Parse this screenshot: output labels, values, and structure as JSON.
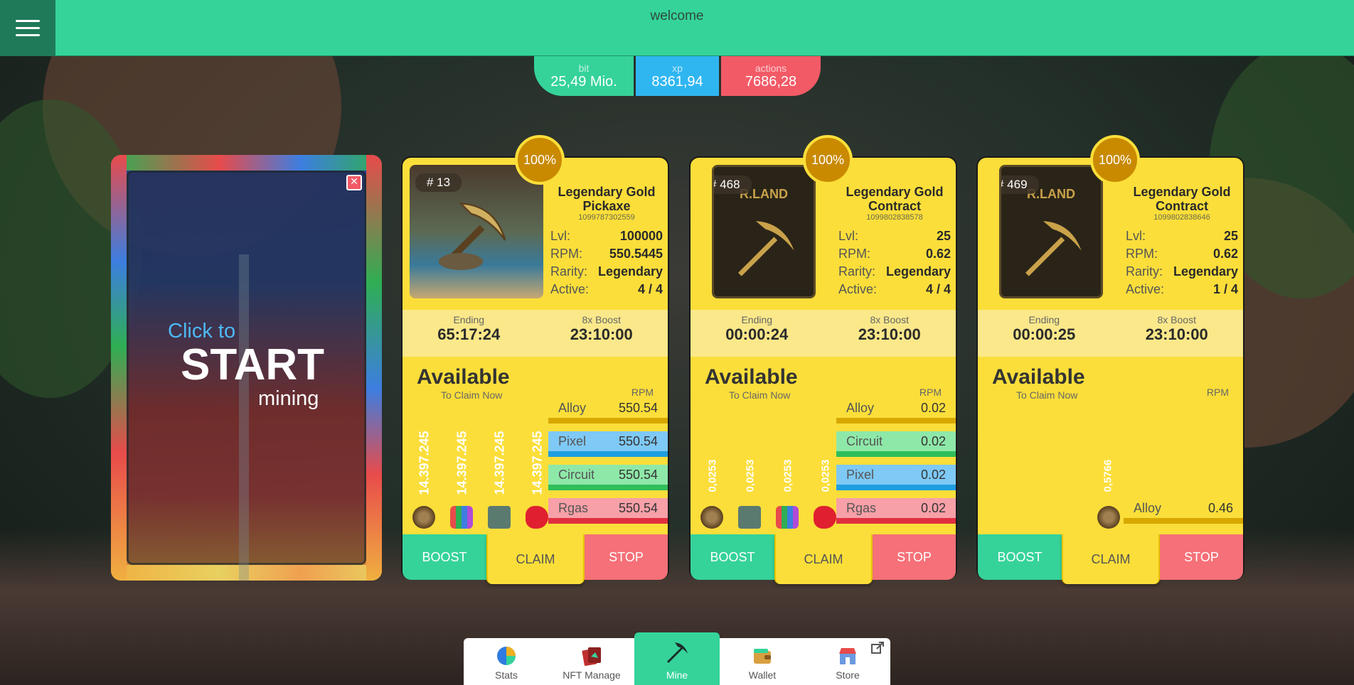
{
  "header": {
    "welcome": "welcome"
  },
  "stats": {
    "bit": {
      "label": "bit",
      "value": "25,49 Mio."
    },
    "xp": {
      "label": "xp",
      "value": "8361,94"
    },
    "actions": {
      "label": "actions",
      "value": "7686,28"
    }
  },
  "start": {
    "click": "Click to",
    "big": "START",
    "mining": "mining",
    "close": "✕"
  },
  "cards": [
    {
      "percent": "100%",
      "number": "# 13",
      "name": "Legendary Gold Pickaxe",
      "id": "1099787302559",
      "lvl_label": "Lvl:",
      "lvl": "100000",
      "rpm_label": "RPM:",
      "rpm": "550.5445",
      "rarity_label": "Rarity:",
      "rarity": "Legendary",
      "active_label": "Active:",
      "active": "4 / 4",
      "ending_label": "Ending",
      "ending": "65:17:24",
      "boost_label": "8x Boost",
      "boost": "23:10:00",
      "available": "Available",
      "to_claim": "To Claim Now",
      "rpm_head": "RPM",
      "claim_values": [
        "14.397.245",
        "14.397.245",
        "14.397.245",
        "14.397.245"
      ],
      "resources": [
        {
          "name": "Alloy",
          "value": "550.54"
        },
        {
          "name": "Pixel",
          "value": "550.54"
        },
        {
          "name": "Circuit",
          "value": "550.54"
        },
        {
          "name": "Rgas",
          "value": "550.54"
        }
      ],
      "buttons": {
        "boost": "BOOST",
        "claim": "CLAIM",
        "stop": "STOP"
      }
    },
    {
      "percent": "100%",
      "number": "# 468",
      "art_label": "R.LAND",
      "name": "Legendary Gold Contract",
      "id": "1099802838578",
      "lvl_label": "Lvl:",
      "lvl": "25",
      "rpm_label": "RPM:",
      "rpm": "0.62",
      "rarity_label": "Rarity:",
      "rarity": "Legendary",
      "active_label": "Active:",
      "active": "4 / 4",
      "ending_label": "Ending",
      "ending": "00:00:24",
      "boost_label": "8x Boost",
      "boost": "23:10:00",
      "available": "Available",
      "to_claim": "To Claim Now",
      "rpm_head": "RPM",
      "claim_values": [
        "0,0253",
        "0,0253",
        "0,0253",
        "0,0253"
      ],
      "resources": [
        {
          "name": "Alloy",
          "value": "0.02"
        },
        {
          "name": "Circuit",
          "value": "0.02"
        },
        {
          "name": "Pixel",
          "value": "0.02"
        },
        {
          "name": "Rgas",
          "value": "0.02"
        }
      ],
      "buttons": {
        "boost": "BOOST",
        "claim": "CLAIM",
        "stop": "STOP"
      }
    },
    {
      "percent": "100%",
      "number": "# 469",
      "art_label": "R.LAND",
      "name": "Legendary Gold Contract",
      "id": "1099802838646",
      "lvl_label": "Lvl:",
      "lvl": "25",
      "rpm_label": "RPM:",
      "rpm": "0.62",
      "rarity_label": "Rarity:",
      "rarity": "Legendary",
      "active_label": "Active:",
      "active": "1 / 4",
      "ending_label": "Ending",
      "ending": "00:00:25",
      "boost_label": "8x Boost",
      "boost": "23:10:00",
      "available": "Available",
      "to_claim": "To Claim Now",
      "rpm_head": "RPM",
      "claim_values": [
        "0,5766"
      ],
      "resources": [
        {
          "name": "Alloy",
          "value": "0.46"
        }
      ],
      "buttons": {
        "boost": "BOOST",
        "claim": "CLAIM",
        "stop": "STOP"
      }
    }
  ],
  "nav": [
    {
      "label": "Stats",
      "icon": "pie-chart-icon"
    },
    {
      "label": "NFT Manage",
      "icon": "cards-icon"
    },
    {
      "label": "Mine",
      "icon": "pickaxe-icon",
      "active": true
    },
    {
      "label": "Wallet",
      "icon": "wallet-icon"
    },
    {
      "label": "Store",
      "icon": "store-icon"
    }
  ],
  "colors": {
    "green": "#35d39a",
    "blue": "#2fb6f0",
    "red": "#f25a66",
    "yellow": "#fbde3a"
  }
}
